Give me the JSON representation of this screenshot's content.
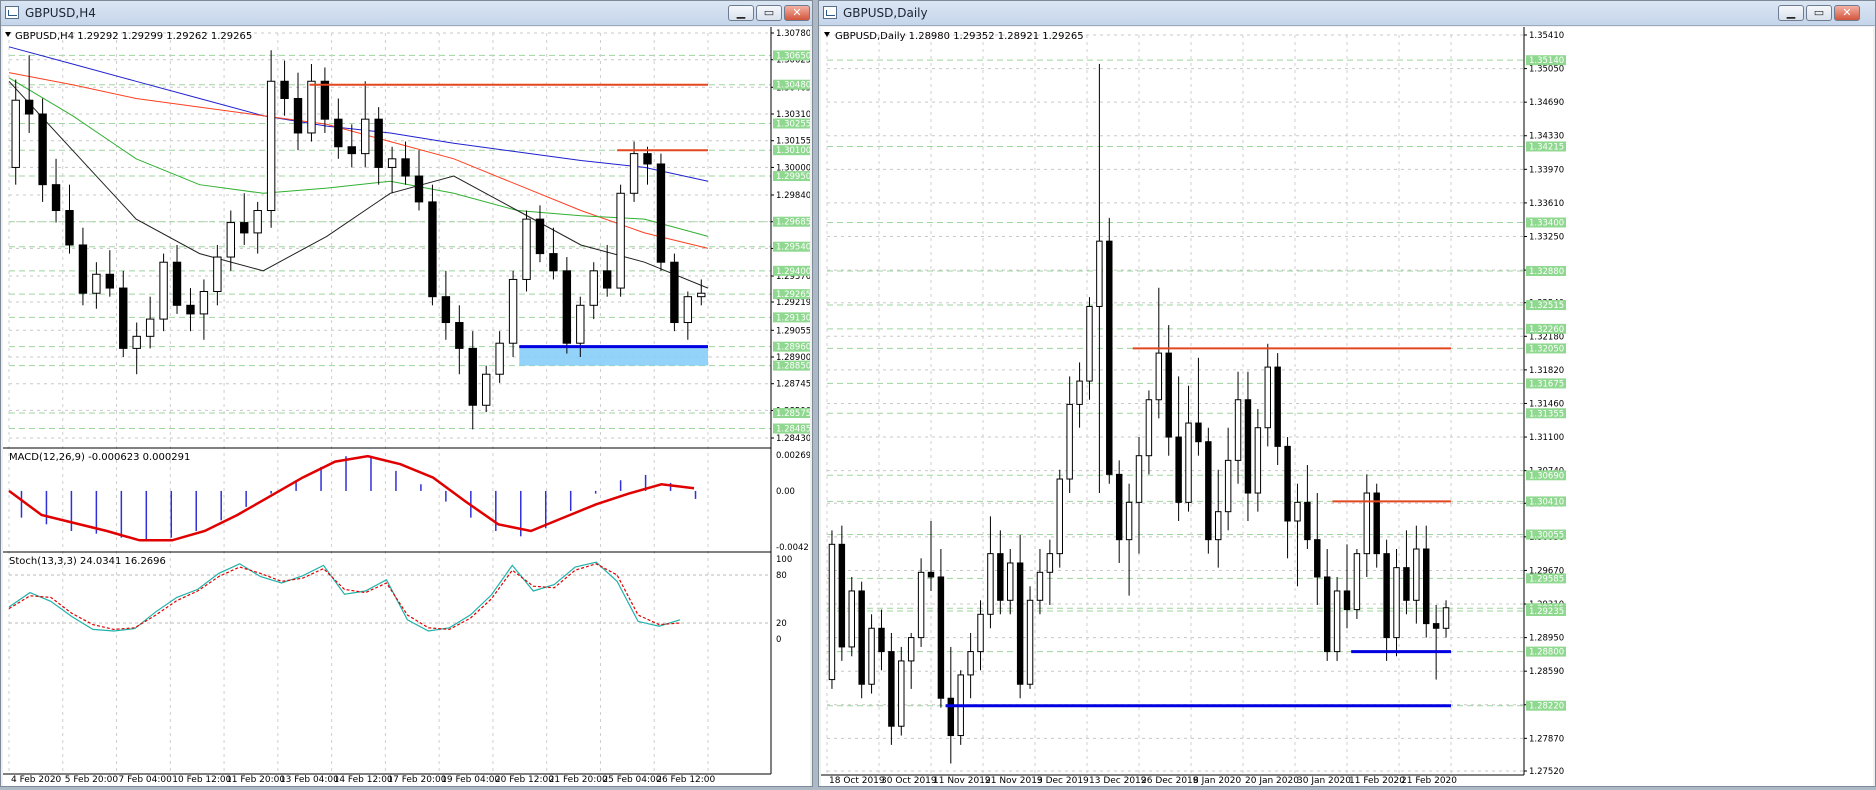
{
  "left": {
    "title": "GBPUSD,H4",
    "info": "GBPUSD,H4  1.29292 1.29299 1.29262 1.29265",
    "price_ticks": [
      "1.30780",
      "1.30625",
      "1.30465",
      "1.30310",
      "1.30155",
      "1.30000",
      "1.29840",
      "1.29685",
      "1.29530",
      "1.29370",
      "1.29219",
      "1.29055",
      "1.28900",
      "1.28745",
      "1.28590",
      "1.28430"
    ],
    "green_labels": [
      "1.30650",
      "1.30480",
      "1.30255",
      "1.30100",
      "1.29950",
      "1.29685",
      "1.29540",
      "1.29400",
      "1.29265",
      "1.29130",
      "1.28960",
      "1.28850",
      "1.28575",
      "1.28485"
    ],
    "time_labels": [
      "4 Feb 2020",
      "5 Feb 20:00",
      "7 Feb 04:00",
      "10 Feb 12:00",
      "11 Feb 20:00",
      "13 Feb 04:00",
      "14 Feb 12:00",
      "17 Feb 20:00",
      "19 Feb 04:00",
      "20 Feb 12:00",
      "21 Feb 20:00",
      "25 Feb 04:00",
      "26 Feb 12:00"
    ],
    "macd_label": "MACD(12,26,9) -0.000623 0.000291",
    "macd_ticks": [
      "0.002691",
      "0.00",
      "-0.0042"
    ],
    "stoch_label": "Stoch(13,3,3) 24.0341 16.2696",
    "stoch_ticks": [
      "100",
      "80",
      "20",
      "0"
    ]
  },
  "right": {
    "title": "GBPUSD,Daily",
    "info": "GBPUSD,Daily  1.28980 1.29352 1.28921 1.29265",
    "price_ticks": [
      "1.35410",
      "1.35050",
      "1.34690",
      "1.34330",
      "1.33970",
      "1.33610",
      "1.33250",
      "1.32890",
      "1.32540",
      "1.32180",
      "1.31820",
      "1.31460",
      "1.31100",
      "1.30740",
      "1.30390",
      "1.30030",
      "1.29670",
      "1.29310",
      "1.28950",
      "1.28590",
      "1.28230",
      "1.27870",
      "1.27520"
    ],
    "green_labels": [
      "1.35140",
      "1.34215",
      "1.33400",
      "1.32880",
      "1.32515",
      "1.32260",
      "1.32050",
      "1.31675",
      "1.31355",
      "1.30690",
      "1.30410",
      "1.30055",
      "1.29585",
      "1.29265",
      "1.29235",
      "1.28800",
      "1.28220"
    ],
    "time_labels": [
      "18 Oct 2019",
      "30 Oct 2019",
      "11 Nov 2019",
      "21 Nov 2019",
      "3 Dec 2019",
      "13 Dec 2019",
      "26 Dec 2019",
      "8 Jan 2020",
      "20 Jan 2020",
      "30 Jan 2020",
      "11 Feb 2020",
      "21 Feb 2020"
    ]
  },
  "colors": {
    "bg": "#ffffff",
    "grid": "#9fd59f",
    "resistance": "#e2471f",
    "support": "#0000e0",
    "macd_hist": "#3030d8",
    "macd_signal": "#e00000",
    "stoch_main": "#20b2aa",
    "stoch_signal": "#e00000",
    "ma_blue": "#2020d0",
    "ma_red": "#ff4020",
    "ma_green": "#30b030",
    "ma_black": "#202020"
  },
  "chart_data": [
    {
      "type": "candlestick",
      "title": "GBPUSD,H4",
      "ylim": [
        1.2843,
        1.3078
      ],
      "ohlc": [
        [
          1.3,
          1.3051,
          1.299,
          1.3039
        ],
        [
          1.3039,
          1.3065,
          1.302,
          1.3031
        ],
        [
          1.3031,
          1.304,
          1.298,
          1.299
        ],
        [
          1.299,
          1.3005,
          1.2968,
          1.2975
        ],
        [
          1.2975,
          1.299,
          1.295,
          1.2955
        ],
        [
          1.2955,
          1.2965,
          1.292,
          1.2927
        ],
        [
          1.2927,
          1.2945,
          1.2918,
          1.2938
        ],
        [
          1.2938,
          1.2952,
          1.2925,
          1.293
        ],
        [
          1.293,
          1.294,
          1.289,
          1.2895
        ],
        [
          1.2895,
          1.291,
          1.288,
          1.2902
        ],
        [
          1.2902,
          1.2925,
          1.2895,
          1.2912
        ],
        [
          1.2912,
          1.295,
          1.2905,
          1.2945
        ],
        [
          1.2945,
          1.2955,
          1.2915,
          1.292
        ],
        [
          1.292,
          1.293,
          1.2905,
          1.2915
        ],
        [
          1.2915,
          1.2935,
          1.29,
          1.2928
        ],
        [
          1.2928,
          1.2955,
          1.292,
          1.2948
        ],
        [
          1.2948,
          1.2975,
          1.294,
          1.2968
        ],
        [
          1.2968,
          1.2985,
          1.2955,
          1.2962
        ],
        [
          1.2962,
          1.298,
          1.295,
          1.2975
        ],
        [
          1.2975,
          1.3068,
          1.2965,
          1.305
        ],
        [
          1.305,
          1.3062,
          1.303,
          1.304
        ],
        [
          1.304,
          1.3055,
          1.301,
          1.302
        ],
        [
          1.302,
          1.306,
          1.3015,
          1.305
        ],
        [
          1.305,
          1.3058,
          1.302,
          1.3028
        ],
        [
          1.3028,
          1.304,
          1.3005,
          1.3012
        ],
        [
          1.3012,
          1.3025,
          1.3,
          1.3008
        ],
        [
          1.3008,
          1.305,
          1.3,
          1.3028
        ],
        [
          1.3028,
          1.3035,
          1.299,
          1.3
        ],
        [
          1.3,
          1.3012,
          1.2985,
          1.3005
        ],
        [
          1.3005,
          1.3015,
          1.299,
          1.2995
        ],
        [
          1.2995,
          1.301,
          1.2975,
          1.298
        ],
        [
          1.298,
          1.299,
          1.292,
          1.2925
        ],
        [
          1.2925,
          1.294,
          1.29,
          1.291
        ],
        [
          1.291,
          1.292,
          1.288,
          1.2895
        ],
        [
          1.2895,
          1.2905,
          1.2848,
          1.2862
        ],
        [
          1.2862,
          1.2885,
          1.2858,
          1.288
        ],
        [
          1.288,
          1.2905,
          1.2875,
          1.2898
        ],
        [
          1.2898,
          1.294,
          1.289,
          1.2935
        ],
        [
          1.2935,
          1.2975,
          1.2928,
          1.297
        ],
        [
          1.297,
          1.2978,
          1.2945,
          1.295
        ],
        [
          1.295,
          1.2965,
          1.2935,
          1.294
        ],
        [
          1.294,
          1.2948,
          1.2892,
          1.2898
        ],
        [
          1.2898,
          1.2925,
          1.289,
          1.292
        ],
        [
          1.292,
          1.2945,
          1.2912,
          1.294
        ],
        [
          1.294,
          1.2955,
          1.2925,
          1.293
        ],
        [
          1.293,
          1.299,
          1.2925,
          1.2985
        ],
        [
          1.2985,
          1.3015,
          1.298,
          1.3008
        ],
        [
          1.3008,
          1.3012,
          1.299,
          1.3002
        ],
        [
          1.3002,
          1.3008,
          1.294,
          1.2945
        ],
        [
          1.2945,
          1.295,
          1.2905,
          1.291
        ],
        [
          1.291,
          1.2928,
          1.29,
          1.2925
        ],
        [
          1.2925,
          1.2935,
          1.292,
          1.2927
        ]
      ],
      "moving_averages": [
        {
          "name": "blue",
          "values": [
            1.307,
            1.306,
            1.305,
            1.304,
            1.303,
            1.3024,
            1.302,
            1.3014,
            1.3009,
            1.3004,
            1.3,
            1.2992
          ]
        },
        {
          "name": "red",
          "values": [
            1.3055,
            1.3048,
            1.304,
            1.3035,
            1.303,
            1.3025,
            1.3015,
            1.3005,
            1.299,
            1.2975,
            1.2962,
            1.2953
          ]
        },
        {
          "name": "green",
          "values": [
            1.3052,
            1.303,
            1.3005,
            1.299,
            1.2985,
            1.2988,
            1.2992,
            1.2985,
            1.2975,
            1.2972,
            1.297,
            1.296
          ]
        },
        {
          "name": "black",
          "values": [
            1.305,
            1.301,
            1.297,
            1.295,
            1.294,
            1.296,
            1.2985,
            1.2995,
            1.2975,
            1.2955,
            1.2945,
            1.293
          ]
        }
      ],
      "levels": [
        {
          "kind": "resistance",
          "price": 1.3048,
          "from": 0.43,
          "to": 1.0
        },
        {
          "kind": "resistance",
          "price": 1.301,
          "from": 0.87,
          "to": 1.0
        },
        {
          "kind": "support",
          "price": 1.2896,
          "from": 0.73,
          "to": 1.0
        },
        {
          "kind": "support-zone",
          "from_price": 1.2896,
          "to_price": 1.2885,
          "from": 0.73,
          "to": 1.0
        }
      ],
      "macd": {
        "ylim": [
          -0.0042,
          0.002691
        ],
        "hist": [
          -0.002,
          -0.0025,
          -0.003,
          -0.0032,
          -0.0035,
          -0.0036,
          -0.0035,
          -0.003,
          -0.0022,
          -0.0012,
          -0.0002,
          0.0008,
          0.0018,
          0.0026,
          0.0025,
          0.0015,
          0.0005,
          -0.0008,
          -0.002,
          -0.003,
          -0.0034,
          -0.0028,
          -0.0015,
          -0.0002,
          0.0008,
          0.0012,
          0.0006,
          -0.0006
        ],
        "signal": [
          0.0,
          -0.0018,
          -0.0024,
          -0.003,
          -0.0037,
          -0.0037,
          -0.003,
          -0.0018,
          -0.0004,
          0.001,
          0.0022,
          0.0026,
          0.002,
          0.001,
          -0.0008,
          -0.0025,
          -0.003,
          -0.002,
          -0.001,
          -0.0002,
          0.0005,
          0.0002
        ]
      },
      "stochastic": {
        "ylim": [
          0,
          100
        ],
        "levels": [
          20,
          80
        ],
        "main": [
          40,
          58,
          47,
          28,
          12,
          10,
          13,
          34,
          52,
          62,
          82,
          94,
          78,
          70,
          79,
          92,
          56,
          60,
          74,
          24,
          10,
          14,
          30,
          55,
          92,
          60,
          68,
          90,
          96,
          72,
          22,
          16,
          24
        ],
        "signal": [
          38,
          54,
          52,
          32,
          18,
          12,
          14,
          30,
          48,
          60,
          78,
          90,
          82,
          72,
          76,
          88,
          62,
          58,
          70,
          30,
          14,
          12,
          26,
          50,
          86,
          66,
          64,
          86,
          94,
          80,
          30,
          18,
          20
        ]
      }
    },
    {
      "type": "candlestick",
      "title": "GBPUSD,Daily",
      "ylim": [
        1.2752,
        1.3541
      ],
      "ohlc": [
        [
          1.285,
          1.301,
          1.284,
          1.2995
        ],
        [
          1.2995,
          1.3015,
          1.287,
          1.2885
        ],
        [
          1.2885,
          1.296,
          1.2875,
          1.2945
        ],
        [
          1.2945,
          1.2955,
          1.283,
          1.2845
        ],
        [
          1.2845,
          1.292,
          1.2835,
          1.2905
        ],
        [
          1.2905,
          1.2925,
          1.286,
          1.288
        ],
        [
          1.288,
          1.29,
          1.278,
          1.28
        ],
        [
          1.28,
          1.2885,
          1.279,
          1.287
        ],
        [
          1.287,
          1.29,
          1.284,
          1.2895
        ],
        [
          1.2895,
          1.298,
          1.2885,
          1.2965
        ],
        [
          1.2965,
          1.302,
          1.2945,
          1.296
        ],
        [
          1.296,
          1.299,
          1.282,
          1.283
        ],
        [
          1.283,
          1.2885,
          1.276,
          1.279
        ],
        [
          1.279,
          1.286,
          1.278,
          1.2855
        ],
        [
          1.2855,
          1.29,
          1.283,
          1.288
        ],
        [
          1.288,
          1.2935,
          1.286,
          1.292
        ],
        [
          1.292,
          1.3025,
          1.2905,
          1.2985
        ],
        [
          1.2985,
          1.301,
          1.292,
          1.2935
        ],
        [
          1.2935,
          1.299,
          1.292,
          1.2975
        ],
        [
          1.2975,
          1.3005,
          1.283,
          1.2845
        ],
        [
          1.2845,
          1.295,
          1.284,
          1.2935
        ],
        [
          1.2935,
          1.299,
          1.292,
          1.2965
        ],
        [
          1.2965,
          1.3,
          1.293,
          1.2985
        ],
        [
          1.2985,
          1.3075,
          1.297,
          1.3065
        ],
        [
          1.3065,
          1.3175,
          1.305,
          1.3145
        ],
        [
          1.3145,
          1.319,
          1.312,
          1.317
        ],
        [
          1.317,
          1.326,
          1.315,
          1.325
        ],
        [
          1.325,
          1.351,
          1.305,
          1.332
        ],
        [
          1.332,
          1.3345,
          1.306,
          1.307
        ],
        [
          1.307,
          1.3085,
          1.2975,
          1.3
        ],
        [
          1.3,
          1.306,
          1.294,
          1.304
        ],
        [
          1.304,
          1.311,
          1.2985,
          1.309
        ],
        [
          1.309,
          1.316,
          1.307,
          1.315
        ],
        [
          1.315,
          1.327,
          1.313,
          1.32
        ],
        [
          1.32,
          1.323,
          1.309,
          1.311
        ],
        [
          1.311,
          1.3175,
          1.302,
          1.304
        ],
        [
          1.304,
          1.3165,
          1.303,
          1.3125
        ],
        [
          1.3125,
          1.3195,
          1.309,
          1.3105
        ],
        [
          1.3105,
          1.312,
          1.2985,
          1.3
        ],
        [
          1.3,
          1.3075,
          1.297,
          1.303
        ],
        [
          1.303,
          1.312,
          1.301,
          1.3085
        ],
        [
          1.3085,
          1.318,
          1.306,
          1.315
        ],
        [
          1.315,
          1.318,
          1.302,
          1.305
        ],
        [
          1.305,
          1.314,
          1.303,
          1.312
        ],
        [
          1.312,
          1.321,
          1.31,
          1.3185
        ],
        [
          1.3185,
          1.32,
          1.308,
          1.31
        ],
        [
          1.31,
          1.311,
          1.298,
          1.302
        ],
        [
          1.302,
          1.306,
          1.295,
          1.304
        ],
        [
          1.304,
          1.308,
          1.299,
          1.3
        ],
        [
          1.3,
          1.305,
          1.293,
          1.296
        ],
        [
          1.296,
          1.299,
          1.287,
          1.288
        ],
        [
          1.288,
          1.296,
          1.287,
          1.2945
        ],
        [
          1.2945,
          1.2995,
          1.2905,
          1.2925
        ],
        [
          1.2925,
          1.299,
          1.2915,
          1.2985
        ],
        [
          1.2985,
          1.307,
          1.296,
          1.305
        ],
        [
          1.305,
          1.306,
          1.297,
          1.2985
        ],
        [
          1.2985,
          1.3,
          1.287,
          1.2895
        ],
        [
          1.2895,
          1.299,
          1.2875,
          1.297
        ],
        [
          1.297,
          1.301,
          1.292,
          1.2935
        ],
        [
          1.2935,
          1.3015,
          1.291,
          1.299
        ],
        [
          1.299,
          1.3015,
          1.2895,
          1.291
        ],
        [
          1.291,
          1.293,
          1.285,
          1.2905
        ],
        [
          1.2905,
          1.2935,
          1.2895,
          1.2927
        ]
      ],
      "levels": [
        {
          "kind": "resistance",
          "price": 1.3205,
          "from": 0.49,
          "to": 1.0
        },
        {
          "kind": "resistance",
          "price": 1.3041,
          "from": 0.81,
          "to": 1.0
        },
        {
          "kind": "support",
          "price": 1.288,
          "from": 0.84,
          "to": 1.0
        },
        {
          "kind": "support",
          "price": 1.2822,
          "from": 0.19,
          "to": 1.0
        }
      ]
    }
  ]
}
